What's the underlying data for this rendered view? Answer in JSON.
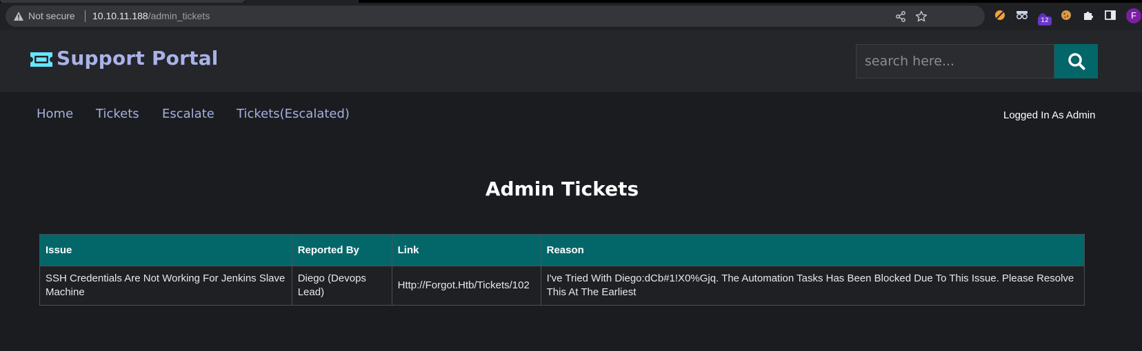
{
  "browser": {
    "security_label": "Not secure",
    "url_host": "10.10.11.188",
    "url_path": "/admin_tickets",
    "extension_badge": "12",
    "profile_initial": "F"
  },
  "header": {
    "title": "Support Portal",
    "search_placeholder": "search here...",
    "logo_icon": "ticket-icon",
    "search_icon": "search-icon",
    "accent_color": "#03676a",
    "title_color": "#aab2e8"
  },
  "nav": {
    "items": [
      {
        "label": "Home"
      },
      {
        "label": "Tickets"
      },
      {
        "label": "Escalate"
      },
      {
        "label": "Tickets(Escalated)"
      }
    ],
    "user_status": "Logged In As Admin"
  },
  "main": {
    "heading": "Admin Tickets",
    "table": {
      "headers": [
        "Issue",
        "Reported By",
        "Link",
        "Reason"
      ],
      "rows": [
        {
          "issue": "SSH Credentials Are Not Working For Jenkins Slave Machine",
          "reported_by": "Diego (Devops Lead)",
          "link": "Http://Forgot.Htb/Tickets/102",
          "reason": "I've Tried With Diego:dCb#1!X0%Gjq. The Automation Tasks Has Been Blocked Due To This Issue. Please Resolve This At The Earliest"
        }
      ]
    }
  }
}
